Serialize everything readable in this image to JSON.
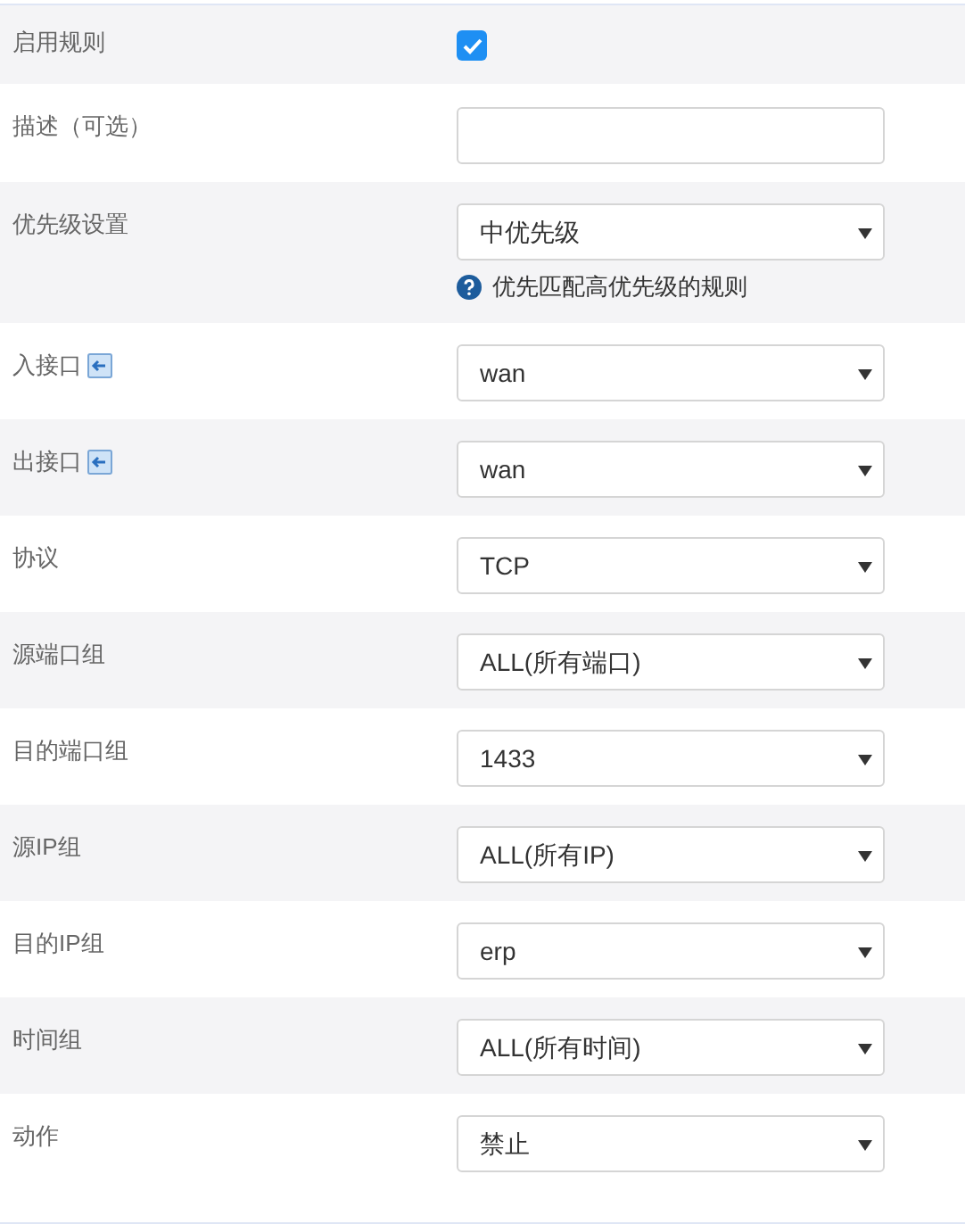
{
  "rows": [
    {
      "label": "启用规则",
      "kind": "checkbox",
      "checked": true
    },
    {
      "label": "描述（可选）",
      "kind": "text"
    },
    {
      "label": "优先级设置",
      "kind": "select",
      "value": "中优先级",
      "hint": "优先匹配高优先级的规则"
    },
    {
      "label": "入接口",
      "kind": "select",
      "value": "wan",
      "icon": true
    },
    {
      "label": "出接口",
      "kind": "select",
      "value": "wan",
      "icon": true
    },
    {
      "label": "协议",
      "kind": "select",
      "value": "TCP"
    },
    {
      "label": "源端口组",
      "kind": "select",
      "value": "ALL(所有端口)"
    },
    {
      "label": "目的端口组",
      "kind": "select",
      "value": "1433"
    },
    {
      "label": "源IP组",
      "kind": "select",
      "value": "ALL(所有IP)"
    },
    {
      "label": "目的IP组",
      "kind": "select",
      "value": "erp"
    },
    {
      "label": "时间组",
      "kind": "select",
      "value": "ALL(所有时间)"
    },
    {
      "label": "动作",
      "kind": "select",
      "value": "禁止"
    }
  ]
}
